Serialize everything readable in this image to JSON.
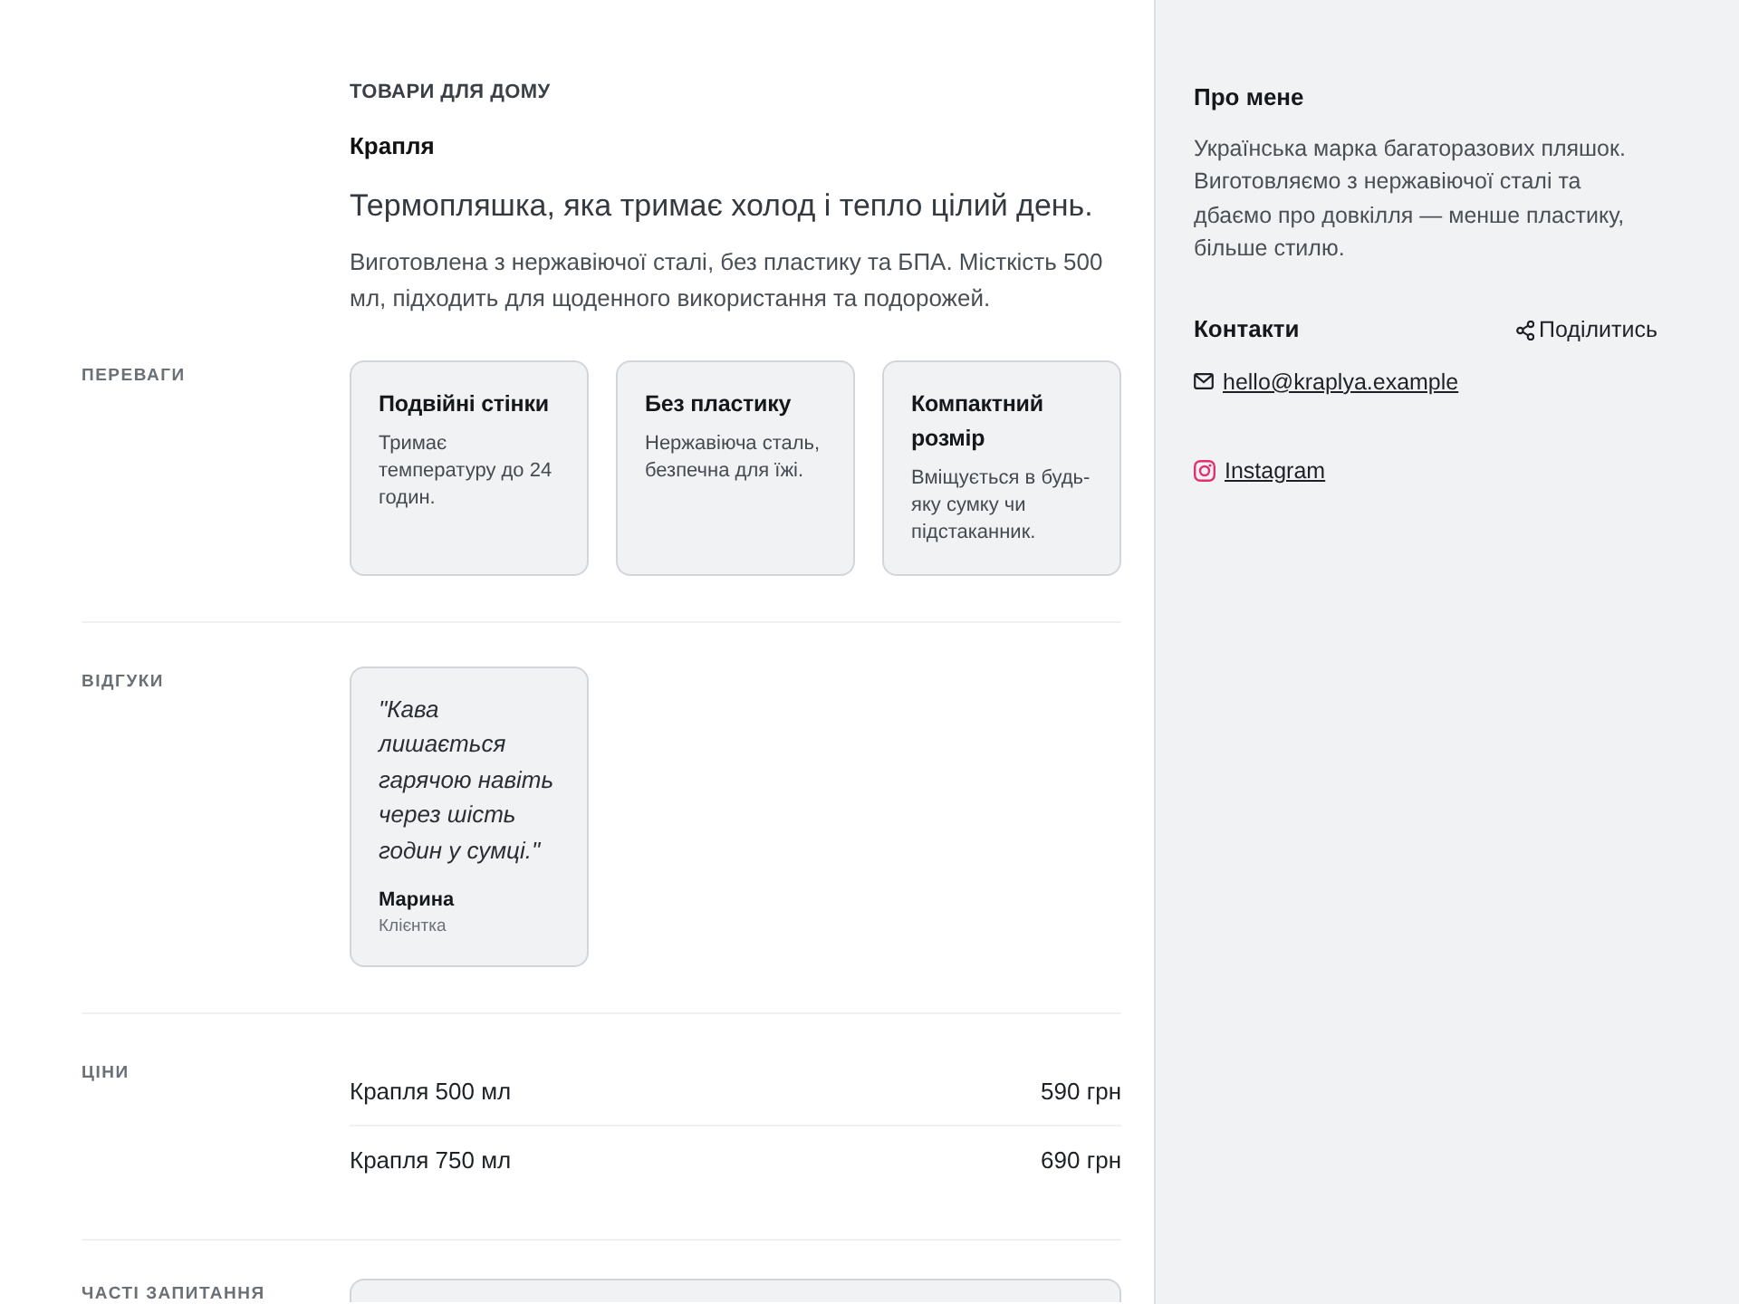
{
  "header": {
    "category": "ТОВАРИ ДЛЯ ДОМУ",
    "brand": "Крапля",
    "tagline": "Термопляшка, яка тримає холод і тепло цілий день.",
    "description": "Виготовлена з нержавіючої сталі, без пластику та БПА. Місткість 500 мл, підходить для щоденного використання та подорожей."
  },
  "sections": [
    {
      "kind": "features",
      "label": "ПЕРЕВАГИ",
      "items": [
        {
          "title": "Подвійні стінки",
          "text": "Тримає температуру до 24 годин."
        },
        {
          "title": "Без пластику",
          "text": "Нержавіюча сталь, безпечна для їжі."
        },
        {
          "title": "Компактний розмір",
          "text": "Вміщується в будь-яку сумку чи підстаканник."
        }
      ]
    },
    {
      "kind": "testimonials",
      "label": "ВІДГУКИ",
      "items": [
        {
          "quote": "\"Кава лишається гарячою навіть через шість годин у сумці.\"",
          "author": "Марина",
          "role": "Клієнтка"
        }
      ]
    },
    {
      "kind": "prices",
      "label": "ЦІНИ",
      "items": [
        {
          "name": "Крапля 500 мл",
          "price": "590 грн"
        },
        {
          "name": "Крапля 750 мл",
          "price": "690 грн"
        }
      ]
    },
    {
      "kind": "faq",
      "label": "ЧАСТІ ЗАПИТАННЯ"
    }
  ],
  "sidebar": {
    "about": {
      "title": "Про мене",
      "text": "Українська марка багаторазових пляшок. Виготовляємо з нержавіючої сталі та дбаємо про довкілля — менше пластику, більше стилю."
    },
    "contacts": {
      "title": "Контакти",
      "share": "Поділитись",
      "links": [
        {
          "kind": "email",
          "text": "hello@kraplya.example"
        },
        {
          "kind": "instagram",
          "text": "Instagram"
        }
      ]
    }
  }
}
